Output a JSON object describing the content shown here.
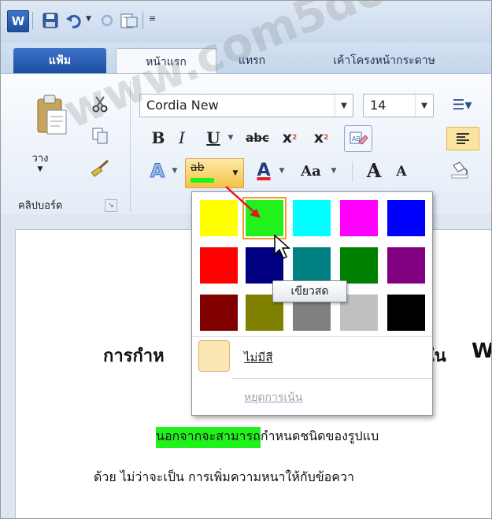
{
  "app": {
    "logo_letter": "W"
  },
  "tabs": {
    "file": "แฟ้ม",
    "home": "หน้าแรก",
    "insert": "แทรก",
    "layout": "เค้าโครงหน้ากระดาษ"
  },
  "ribbon": {
    "paste_label": "วาง",
    "clipboard_group": "คลิปบอร์ด",
    "font_name": "Cordia New",
    "font_size": "14",
    "bold": "B",
    "italic": "I",
    "underline": "U",
    "strike": "abc",
    "subscript": "x",
    "superscript": "x",
    "change_case": "Aa",
    "grow": "A",
    "shrink": "A",
    "highlight_glyph": "ab",
    "font_color_glyph": "A"
  },
  "palette": {
    "colors": [
      [
        "#ffff00",
        "#21f21b",
        "#00ffff",
        "#ff00ff",
        "#0000ff"
      ],
      [
        "#ff0000",
        "#000080",
        "#008080",
        "#008000",
        "#800080"
      ],
      [
        "#800000",
        "#808000",
        "#808080",
        "#c0c0c0",
        "#000000"
      ]
    ],
    "selected_index": [
      0,
      1
    ],
    "no_color": "ไม่มีสี",
    "stop_highlight": "หยุดการเน้น",
    "tooltip": "เขียวสด"
  },
  "document": {
    "heading_start": "การกำห",
    "heading_mid": "ใน",
    "heading_end": "W",
    "line1_highlight": "นอกจากจะสามารถ",
    "line1_rest": "กำหนดชนิดของรูปแบ",
    "line2": "ด้วย ไม่ว่าจะเป็น การเพิ่มความหนาให้กับข้อควา"
  },
  "watermark": "www.com5dow.com",
  "colors": {
    "accent": "#2b5fb3",
    "highlight": "#21f21b"
  }
}
